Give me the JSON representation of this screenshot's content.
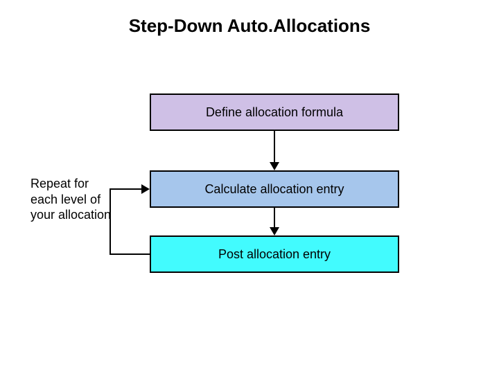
{
  "title": "Step-Down Auto.Allocations",
  "steps": {
    "define": "Define allocation formula",
    "calculate": "Calculate allocation entry",
    "post": "Post allocation entry"
  },
  "loop_label": "Repeat for each level of your allocation",
  "colors": {
    "define_bg": "#cfc0e6",
    "calculate_bg": "#a6c6ec",
    "post_bg": "#42fbfe"
  }
}
